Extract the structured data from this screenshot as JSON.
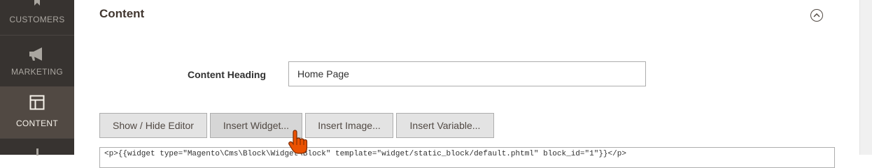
{
  "sidebar": {
    "items": [
      {
        "label": "CUSTOMERS",
        "icon": "customers-icon"
      },
      {
        "label": "MARKETING",
        "icon": "megaphone-icon"
      },
      {
        "label": "CONTENT",
        "icon": "layout-icon",
        "active": true
      },
      {
        "label": "",
        "icon": "stores-icon"
      }
    ]
  },
  "section": {
    "title": "Content",
    "collapse_icon": "chevron-up-icon"
  },
  "form": {
    "heading_label": "Content Heading",
    "heading_value": "Home Page"
  },
  "toolbar": {
    "toggle_editor": "Show / Hide Editor",
    "insert_widget": "Insert Widget...",
    "insert_image": "Insert Image...",
    "insert_variable": "Insert Variable..."
  },
  "editor": {
    "content": "<p>{{widget type=\"Magento\\Cms\\Block\\Widget\\Block\" template=\"widget/static_block/default.phtml\" block_id=\"1\"}}</p>"
  },
  "colors": {
    "sidebar_bg": "#373330",
    "sidebar_active": "#514943",
    "button_bg": "#e3e3e3",
    "cursor_accent": "#eb5202"
  }
}
